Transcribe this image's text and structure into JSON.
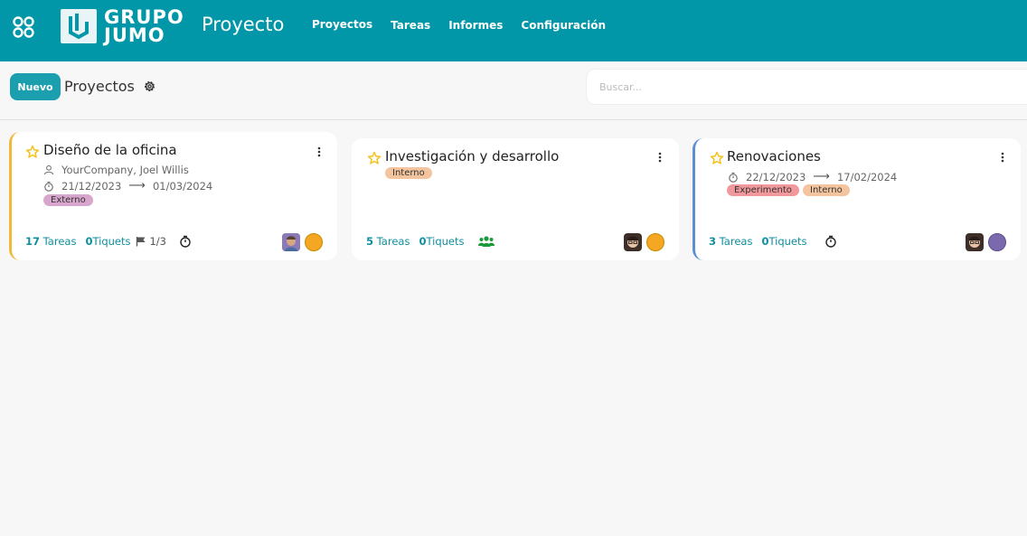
{
  "brand": {
    "line1": "GRUPO",
    "line2": "JUMO"
  },
  "app_title": "Proyecto",
  "nav": [
    "Proyectos",
    "Tareas",
    "Informes",
    "Configuración"
  ],
  "control": {
    "new_label": "Nuevo",
    "breadcrumb": "Proyectos",
    "search_placeholder": "Buscar..."
  },
  "colors": {
    "topbar": "#0197a8",
    "accent": "#1b9eae",
    "link": "#0e8f9f",
    "star": "#f3c21b"
  },
  "cards": [
    {
      "title": "Diseño de la oficina",
      "customer": "YourCompany, Joel Willis",
      "date_start": "21/12/2023",
      "date_end": "01/03/2024",
      "tags": [
        "Externo"
      ],
      "tasks_count": "17",
      "tasks_label": "Tareas",
      "tickets_count": "0",
      "tickets_label": "Tiquets",
      "milestones": "1/3",
      "status_color": "#f5a623"
    },
    {
      "title": "Investigación y desarrollo",
      "tags": [
        "Interno"
      ],
      "tasks_count": "5",
      "tasks_label": "Tareas",
      "tickets_count": "0",
      "tickets_label": "Tiquets",
      "status_color": "#f5a623"
    },
    {
      "title": "Renovaciones",
      "date_start": "22/12/2023",
      "date_end": "17/02/2024",
      "tags": [
        "Experimento",
        "Interno"
      ],
      "tasks_count": "3",
      "tasks_label": "Tareas",
      "tickets_count": "0",
      "tickets_label": "Tiquets",
      "status_color": "#7a6aad"
    }
  ]
}
